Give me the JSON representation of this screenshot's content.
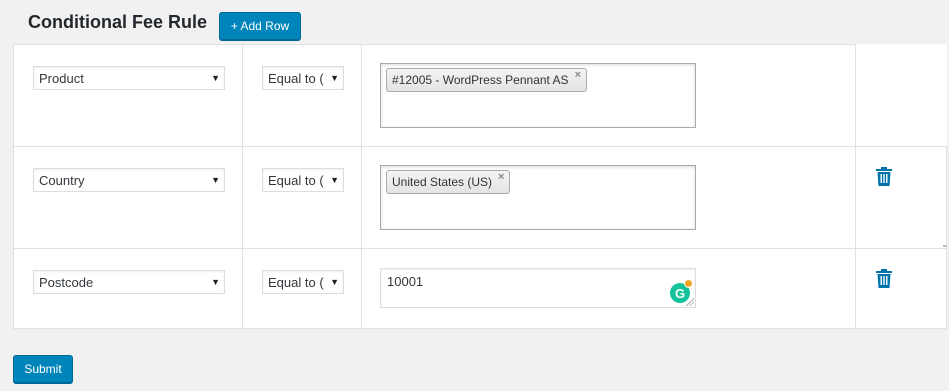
{
  "header": {
    "title": "Conditional Fee Rule",
    "add_row_label": "+ Add Row"
  },
  "rows": [
    {
      "condition": "Product",
      "operator": "Equal to (",
      "value_type": "chips",
      "chips": [
        "#12005 - WordPress Pennant AS"
      ],
      "deletable": false
    },
    {
      "condition": "Country",
      "operator": "Equal to (",
      "value_type": "chips",
      "chips": [
        "United States (US)"
      ],
      "deletable": true
    },
    {
      "condition": "Postcode",
      "operator": "Equal to (",
      "value_type": "text",
      "text_value": "10001",
      "deletable": true
    }
  ],
  "grammarly_letter": "G",
  "chip_remove_glyph": "×",
  "select_arrow_glyph": "▼",
  "footer": {
    "submit_label": "Submit"
  },
  "colors": {
    "primary_button": "#0085ba",
    "delete_icon": "#0073aa",
    "grammarly": "#15c39a"
  }
}
